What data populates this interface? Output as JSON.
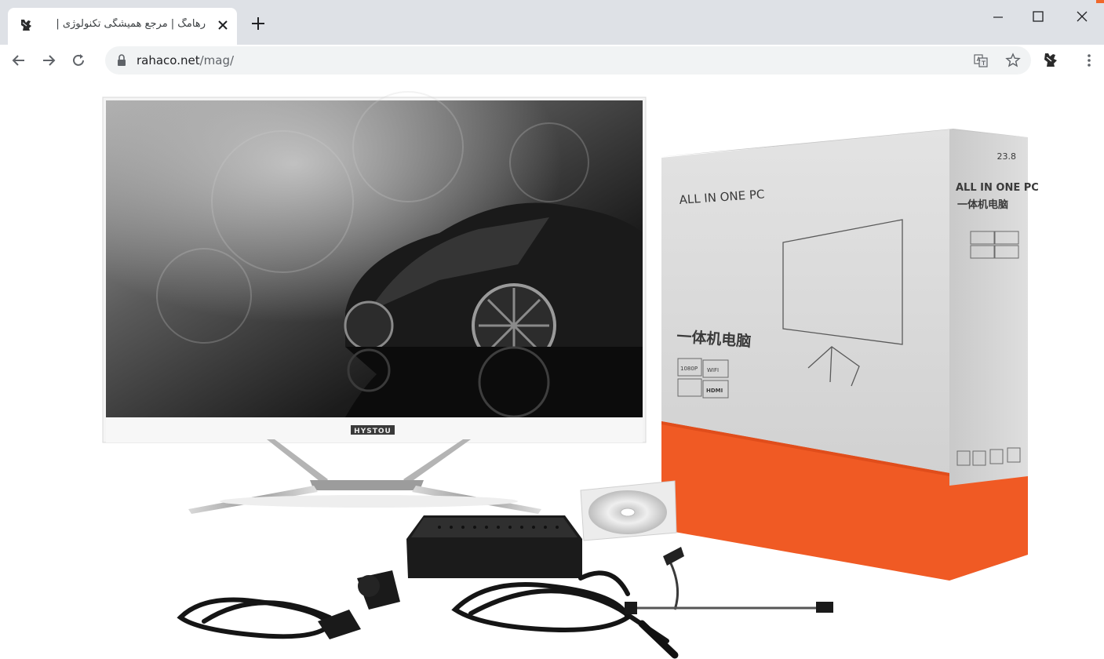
{
  "browser": {
    "tab": {
      "title": "رهامگ | مرجع همیشگی تکنولوژی |"
    },
    "address": {
      "host": "rahaco.net",
      "path": "/mag/"
    }
  },
  "page": {
    "monitor_brand": "HYSTOU",
    "box": {
      "front_title": "ALL IN ONE PC",
      "front_chinese": "一体机电脑",
      "side_size": "23.8",
      "side_title": "ALL IN ONE PC",
      "side_chinese": "一体机电脑",
      "badges": [
        "1080P",
        "WIFI",
        "HDMI"
      ]
    }
  },
  "colors": {
    "tabstrip": "#dee1e6",
    "omnibox": "#f1f3f4",
    "box_orange": "#f05a24",
    "box_gray": "#d9d9d9"
  },
  "icons": [
    "rahaco-favicon-icon",
    "close-icon",
    "plus-icon",
    "minimize-icon",
    "maximize-icon",
    "window-close-icon",
    "back-arrow-icon",
    "forward-arrow-icon",
    "reload-icon",
    "lock-icon",
    "translate-icon",
    "star-icon",
    "extension-icon",
    "more-vert-icon"
  ]
}
